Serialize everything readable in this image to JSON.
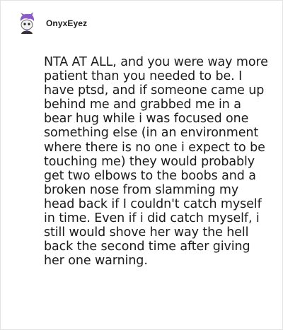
{
  "post": {
    "username": "OnyxEyez",
    "avatar_icon": "purple-haired-character-avatar",
    "text": "NTA AT ALL, and you were way more patient than you needed to be. I have ptsd, and if someone came up behind me and grabbed me in a bear hug while i was focused one something else (in an environment where there is no one i expect to be touching me) they would probably get two elbows to the boobs and a broken nose from slamming my head back if I couldn't catch myself in time. Even if i did catch myself, i still would shove her way the hell back the second time after giving her one warning."
  },
  "colors": {
    "background": "#ffffff",
    "border": "#e3e3e3",
    "text": "#1b1b1b",
    "avatar_accent": "#8b5cc8"
  }
}
